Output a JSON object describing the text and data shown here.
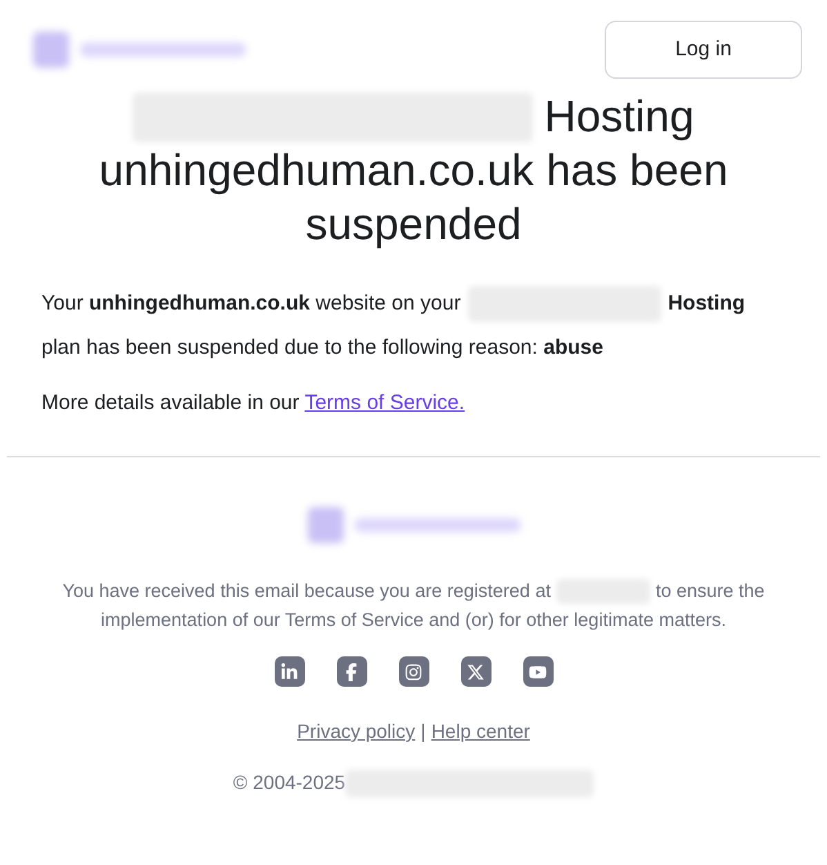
{
  "header": {
    "login_button": "Log in"
  },
  "title": {
    "first_line": "Hosting",
    "rest": "unhingedhuman.co.uk has been suspended"
  },
  "body": {
    "line_before": "Your **unhingedhuman.co.uk** website on your",
    "line_after": "Hosting",
    "line_two": "plan has been suspended due to the following reason: **abuse**",
    "details": "More details available in our",
    "terms_link": "Terms of Service."
  },
  "footer": {
    "notice_before": "You have received this email because you are registered at",
    "notice_after": "to ensure the",
    "notice_line_two": "implementation of our Terms of Service and (or) for other legitimate matters.",
    "social": [
      {
        "kind": "linkedin"
      },
      {
        "kind": "facebook"
      },
      {
        "kind": "instagram"
      },
      {
        "kind": "x"
      },
      {
        "kind": "youtube"
      }
    ],
    "links": [
      "Privacy policy",
      "Help center"
    ],
    "separator": "|",
    "copyright": "© 2004-2025"
  }
}
